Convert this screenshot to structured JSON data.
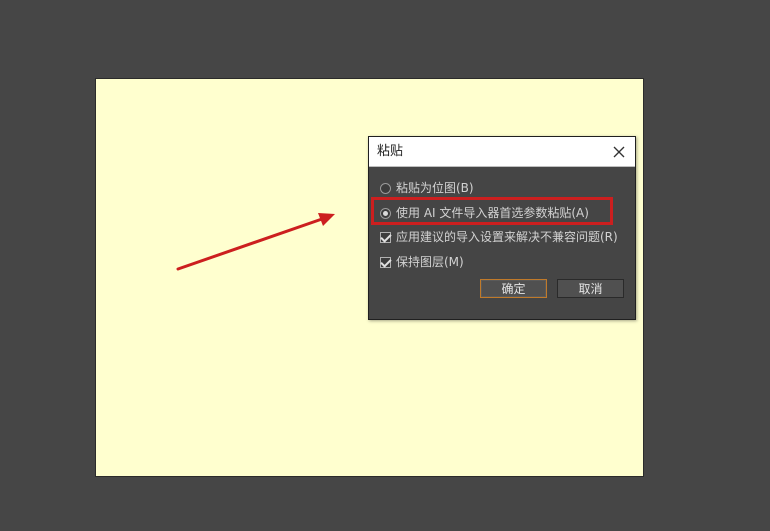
{
  "dialog": {
    "title": "粘贴",
    "close_icon": "close-icon"
  },
  "options": {
    "paste_bitmap": {
      "label": "粘贴为位图(B)",
      "selected": false
    },
    "use_ai_importer": {
      "label": "使用 AI 文件导入器首选参数粘贴(A)",
      "selected": true
    },
    "apply_import_settings": {
      "label": "应用建议的导入设置来解决不兼容问题(R)",
      "checked": true
    },
    "keep_layers": {
      "label": "保持图层(M)",
      "checked": true
    }
  },
  "buttons": {
    "ok_label": "确定",
    "cancel_label": "取消"
  },
  "colors": {
    "background": "#464646",
    "stage": "#ffffcf",
    "dialog_body": "#454545",
    "annotation": "#cc1f1f",
    "default_button_border": "#c07a2a"
  }
}
